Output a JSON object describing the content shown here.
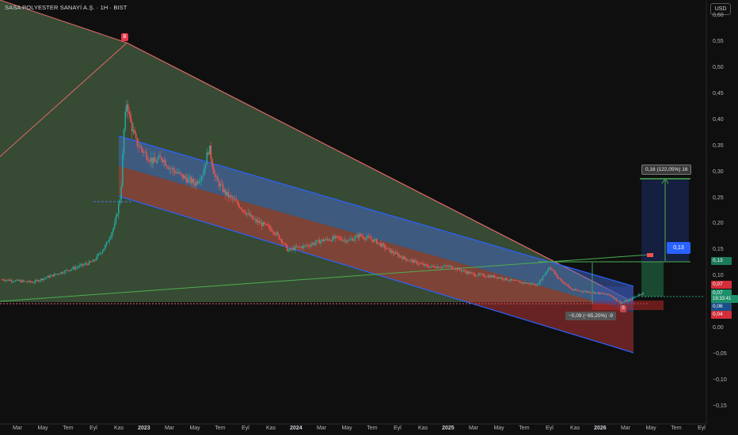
{
  "header": {
    "title": "SASA POLYESTER SANAYİ A.Ş. · 1H · BIST",
    "currency_button": "USD"
  },
  "chart_data": {
    "type": "candlestick",
    "ylim": [
      -0.17,
      0.61
    ],
    "y_ticks": [
      "0,60",
      "0,55",
      "0,50",
      "0,45",
      "0,40",
      "0,35",
      "0,30",
      "0,25",
      "0,20",
      "0,15",
      "0,10",
      "0,05",
      "0,00",
      "−0,05",
      "−0,10",
      "−0,15"
    ],
    "y_tick_values": [
      0.6,
      0.55,
      0.5,
      0.45,
      0.4,
      0.35,
      0.3,
      0.25,
      0.2,
      0.15,
      0.1,
      0.05,
      0.0,
      -0.05,
      -0.1,
      -0.15
    ],
    "x_ticks": [
      {
        "label": "Mar",
        "t": 0.0
      },
      {
        "label": "May",
        "t": 0.167
      },
      {
        "label": "Tem",
        "t": 0.333
      },
      {
        "label": "Eyl",
        "t": 0.5
      },
      {
        "label": "Kas",
        "t": 0.667
      },
      {
        "label": "2023",
        "t": 0.833,
        "year": true
      },
      {
        "label": "Mar",
        "t": 1.0
      },
      {
        "label": "May",
        "t": 1.167
      },
      {
        "label": "Tem",
        "t": 1.333
      },
      {
        "label": "Eyl",
        "t": 1.5
      },
      {
        "label": "Kas",
        "t": 1.667
      },
      {
        "label": "2024",
        "t": 1.833,
        "year": true
      },
      {
        "label": "Mar",
        "t": 2.0
      },
      {
        "label": "May",
        "t": 2.167
      },
      {
        "label": "Tem",
        "t": 2.333
      },
      {
        "label": "Eyl",
        "t": 2.5
      },
      {
        "label": "Kas",
        "t": 2.667
      },
      {
        "label": "2025",
        "t": 2.833,
        "year": true
      },
      {
        "label": "Mar",
        "t": 3.0
      },
      {
        "label": "May",
        "t": 3.167
      },
      {
        "label": "Tem",
        "t": 3.333
      },
      {
        "label": "Eyl",
        "t": 3.5
      },
      {
        "label": "Kas",
        "t": 3.667
      },
      {
        "label": "2026",
        "t": 3.833,
        "year": true
      },
      {
        "label": "Mar",
        "t": 4.0
      },
      {
        "label": "May",
        "t": 4.167
      },
      {
        "label": "Tem",
        "t": 4.333
      },
      {
        "label": "Eyl",
        "t": 4.5
      }
    ],
    "price_path": [
      [
        -0.1,
        0.095
      ],
      [
        0.1,
        0.09
      ],
      [
        0.25,
        0.105
      ],
      [
        0.4,
        0.12
      ],
      [
        0.5,
        0.13
      ],
      [
        0.58,
        0.16
      ],
      [
        0.64,
        0.2
      ],
      [
        0.68,
        0.26
      ],
      [
        0.7,
        0.38
      ],
      [
        0.72,
        0.44
      ],
      [
        0.74,
        0.4
      ],
      [
        0.78,
        0.36
      ],
      [
        0.83,
        0.34
      ],
      [
        0.9,
        0.32
      ],
      [
        0.95,
        0.33
      ],
      [
        1.0,
        0.31
      ],
      [
        1.05,
        0.3
      ],
      [
        1.1,
        0.29
      ],
      [
        1.17,
        0.28
      ],
      [
        1.22,
        0.3
      ],
      [
        1.26,
        0.35
      ],
      [
        1.3,
        0.29
      ],
      [
        1.37,
        0.26
      ],
      [
        1.45,
        0.24
      ],
      [
        1.55,
        0.21
      ],
      [
        1.62,
        0.2
      ],
      [
        1.68,
        0.19
      ],
      [
        1.74,
        0.17
      ],
      [
        1.78,
        0.15
      ],
      [
        1.82,
        0.155
      ],
      [
        1.9,
        0.16
      ],
      [
        2.0,
        0.17
      ],
      [
        2.1,
        0.175
      ],
      [
        2.18,
        0.17
      ],
      [
        2.25,
        0.18
      ],
      [
        2.35,
        0.17
      ],
      [
        2.45,
        0.15
      ],
      [
        2.55,
        0.135
      ],
      [
        2.7,
        0.12
      ],
      [
        2.85,
        0.12
      ],
      [
        3.0,
        0.105
      ],
      [
        3.15,
        0.1
      ],
      [
        3.3,
        0.09
      ],
      [
        3.42,
        0.085
      ],
      [
        3.5,
        0.12
      ],
      [
        3.55,
        0.1
      ],
      [
        3.65,
        0.075
      ],
      [
        3.8,
        0.07
      ],
      [
        3.9,
        0.065
      ],
      [
        3.97,
        0.05
      ],
      [
        4.02,
        0.055
      ],
      [
        4.08,
        0.065
      ],
      [
        4.12,
        0.07
      ]
    ],
    "triangle_apex": {
      "t": 0.72,
      "v": 0.55
    },
    "annotations": {
      "peak_label": "B",
      "low_label": "S",
      "short_measure": "−0,09 (−65,20%) -9",
      "long_measure": "0,16 (122,05%) 16",
      "target_label": "0,13"
    },
    "price_tags": [
      {
        "label": "0,13",
        "v": 0.13,
        "color": "#1b7a5a"
      },
      {
        "label": "0,07",
        "v": 0.085,
        "color": "#d32f3a"
      },
      {
        "label": "0,07",
        "v": 0.068,
        "color": "#1f8f6a"
      },
      {
        "label": "19:33:41",
        "v": 0.058,
        "color": "#1f8f6a"
      },
      {
        "label": "0,06",
        "v": 0.042,
        "color": "#1a4f8a"
      },
      {
        "label": "0,04",
        "v": 0.028,
        "color": "#d32f3a"
      }
    ]
  }
}
